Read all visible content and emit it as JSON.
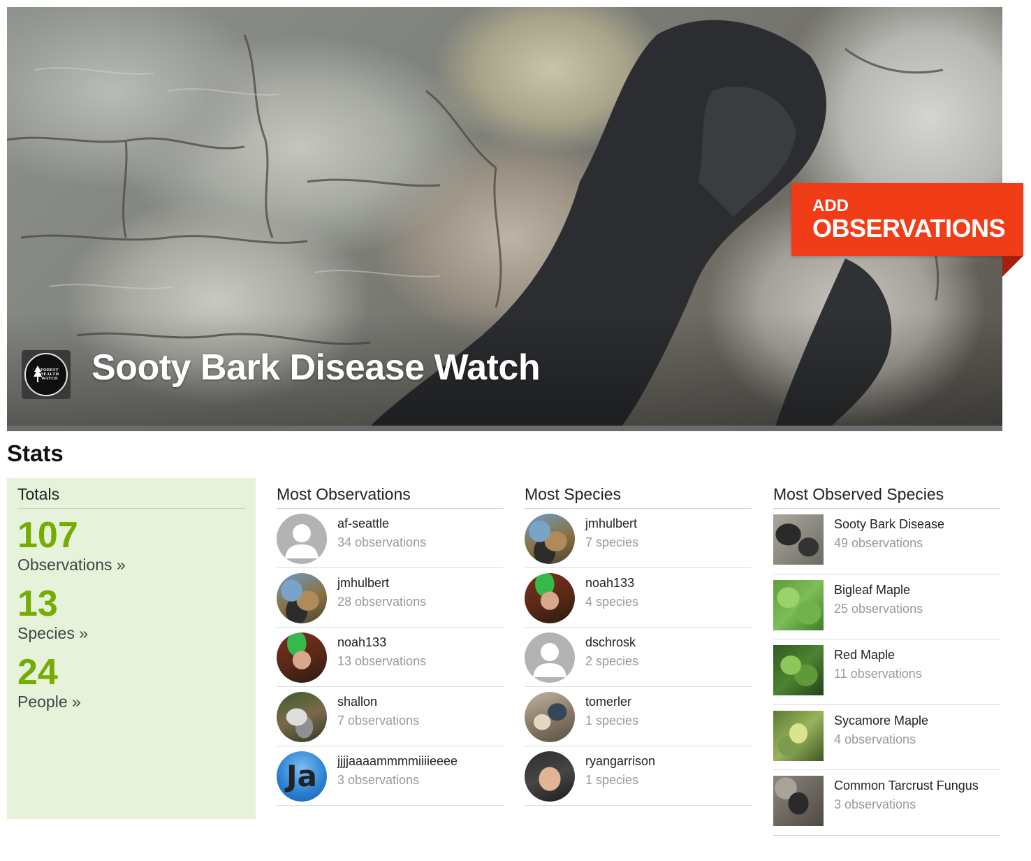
{
  "project": {
    "title": "Sooty Bark Disease Watch",
    "logo_text": [
      "FOREST",
      "HEALTH",
      "WATCH"
    ]
  },
  "ribbon": {
    "line1": "ADD",
    "line2": "OBSERVATIONS"
  },
  "stats": {
    "heading": "Stats",
    "totals": {
      "title": "Totals",
      "observations": {
        "count": "107",
        "label": "Observations »"
      },
      "species": {
        "count": "13",
        "label": "Species »"
      },
      "people": {
        "count": "24",
        "label": "People »"
      }
    },
    "most_observations": {
      "title": "Most Observations",
      "rows": [
        {
          "name": "af-seattle",
          "sub": "34 observations"
        },
        {
          "name": "jmhulbert",
          "sub": "28 observations"
        },
        {
          "name": "noah133",
          "sub": "13 observations"
        },
        {
          "name": "shallon",
          "sub": "7 observations"
        },
        {
          "name": "jjjjaaaammmmiiiieeee",
          "sub": "3 observations"
        }
      ]
    },
    "most_species": {
      "title": "Most Species",
      "rows": [
        {
          "name": "jmhulbert",
          "sub": "7 species"
        },
        {
          "name": "noah133",
          "sub": "4 species"
        },
        {
          "name": "dschrosk",
          "sub": "2 species"
        },
        {
          "name": "tomerler",
          "sub": "1 species"
        },
        {
          "name": "ryangarrison",
          "sub": "1 species"
        }
      ]
    },
    "most_observed_species": {
      "title": "Most Observed Species",
      "rows": [
        {
          "name": "Sooty Bark Disease",
          "sub": "49 observations"
        },
        {
          "name": "Bigleaf Maple",
          "sub": "25 observations"
        },
        {
          "name": "Red Maple",
          "sub": "11 observations"
        },
        {
          "name": "Sycamore Maple",
          "sub": "4 observations"
        },
        {
          "name": "Common Tarcrust Fungus",
          "sub": "3 observations"
        }
      ]
    },
    "avatar_ja_text": "Ja"
  },
  "colors": {
    "accent_green": "#74ac00",
    "totals_bg": "#e7f2da",
    "ribbon": "#f03d17"
  }
}
